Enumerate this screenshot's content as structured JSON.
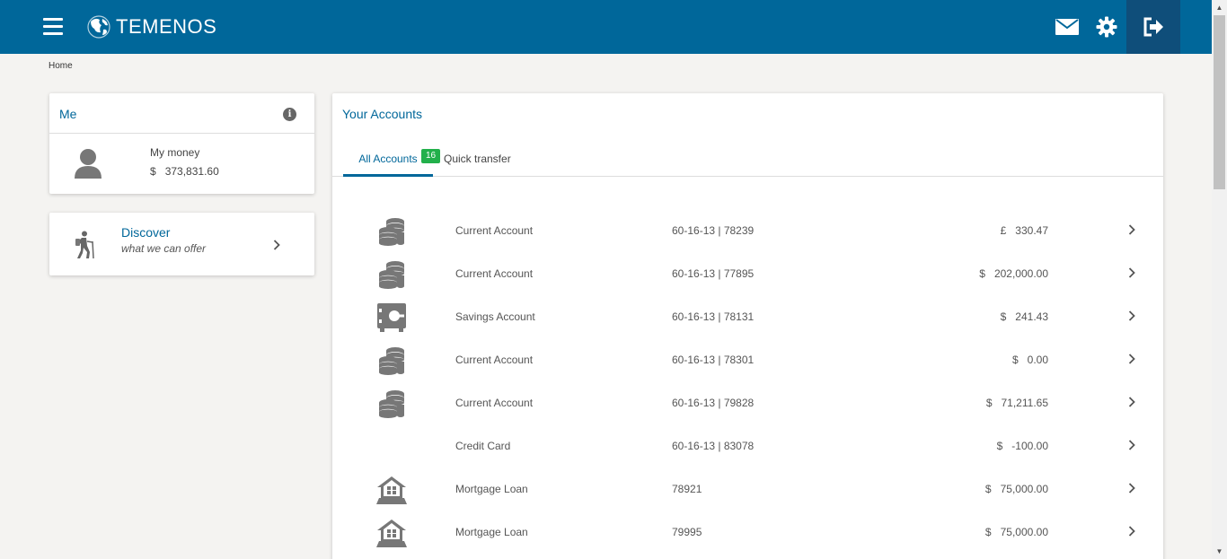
{
  "header": {
    "brand": "TEMENOS",
    "icons": [
      "menu-icon",
      "mail-icon",
      "gear-icon",
      "logout-icon"
    ],
    "color": "#00679a",
    "logout_bg": "#0f4e7a"
  },
  "breadcrumb": "Home",
  "me": {
    "title": "Me",
    "money_label": "My money",
    "currency": "$",
    "money_value": "373,831.60"
  },
  "discover": {
    "title": "Discover",
    "subtitle": "what we can offer"
  },
  "accounts": {
    "title": "Your Accounts",
    "tabs": [
      {
        "label": "All Accounts",
        "badge": "16",
        "active": true
      },
      {
        "label": "Quick transfer",
        "active": false
      }
    ],
    "rows": [
      {
        "icon": "coins-icon",
        "name": "Current Account",
        "number": "60-16-13 | 78239",
        "currency": "£",
        "amount": "330.47"
      },
      {
        "icon": "coins-icon",
        "name": "Current Account",
        "number": "60-16-13 | 77895",
        "currency": "$",
        "amount": "202,000.00"
      },
      {
        "icon": "safe-icon",
        "name": "Savings Account",
        "number": "60-16-13 | 78131",
        "currency": "$",
        "amount": "241.43"
      },
      {
        "icon": "coins-icon",
        "name": "Current Account",
        "number": "60-16-13 | 78301",
        "currency": "$",
        "amount": "0.00"
      },
      {
        "icon": "coins-icon",
        "name": "Current Account",
        "number": "60-16-13 | 79828",
        "currency": "$",
        "amount": "71,211.65"
      },
      {
        "icon": "",
        "name": "Credit Card",
        "number": "60-16-13 | 83078",
        "currency": "$",
        "amount": "-100.00"
      },
      {
        "icon": "house-icon",
        "name": "Mortgage Loan",
        "number": "78921",
        "currency": "$",
        "amount": "75,000.00"
      },
      {
        "icon": "house-icon",
        "name": "Mortgage Loan",
        "number": "79995",
        "currency": "$",
        "amount": "75,000.00"
      }
    ]
  }
}
